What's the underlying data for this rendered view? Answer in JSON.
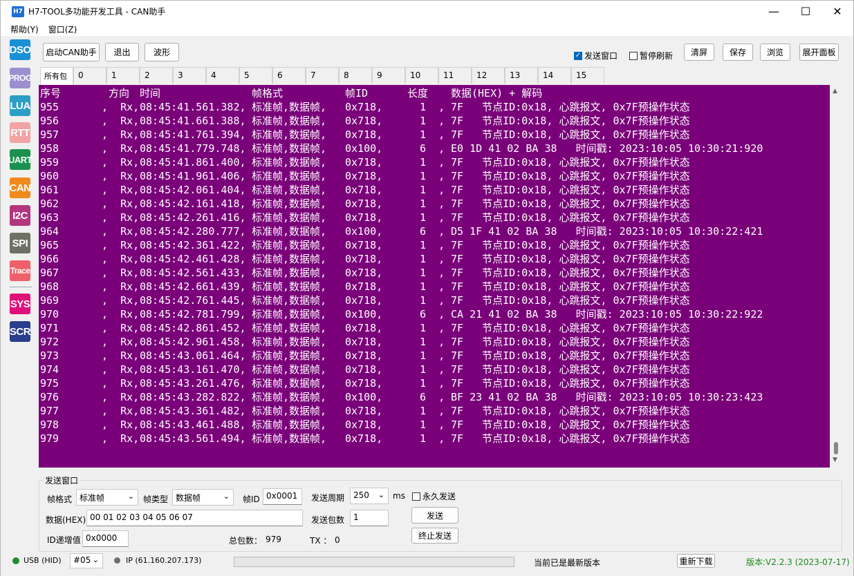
{
  "window": {
    "icon": "H7",
    "title": "H7-TOOL多功能开发工具 - CAN助手",
    "min": "—",
    "max": "☐",
    "close": "✕"
  },
  "menu": [
    "帮助(Y)",
    "窗口(Z)"
  ],
  "sidebar": [
    {
      "label": "DSO",
      "color": "#1a8fd6"
    },
    {
      "label": "PROG",
      "color": "#9c8fd0"
    },
    {
      "label": "LUA",
      "color": "#2a9ec7"
    },
    {
      "label": "RTT",
      "color": "#f2a3a3"
    },
    {
      "label": "UART",
      "color": "#1b9150"
    },
    {
      "label": "CAN",
      "color": "#f08a1c"
    },
    {
      "label": "I2C",
      "color": "#b3357f"
    },
    {
      "label": "SPI",
      "color": "#6f6f63"
    },
    {
      "label": "Trace",
      "color": "#f0606a"
    },
    {
      "label": "SYS",
      "color": "#e0107a"
    },
    {
      "label": "SCR",
      "color": "#2a3e8e"
    }
  ],
  "toolbar": {
    "start_can": "启动CAN助手",
    "exit": "退出",
    "wave": "波形",
    "send_window": "发送窗口",
    "send_window_checked": true,
    "pause_refresh": "暂停刷新",
    "pause_refresh_checked": false,
    "clear": "清屏",
    "save": "保存",
    "browse": "浏览",
    "expand": "展开面板"
  },
  "tabs": [
    "所有包",
    "0",
    "1",
    "2",
    "3",
    "4",
    "5",
    "6",
    "7",
    "8",
    "9",
    "10",
    "11",
    "12",
    "13",
    "14",
    "15"
  ],
  "log": {
    "header": {
      "seq": "序号",
      "dir": "方向",
      "time": "时间",
      "fmt": "帧格式",
      "id": "帧ID",
      "len": "长度",
      "data": "数据(HEX) + 解码"
    },
    "rows": [
      {
        "seq": "955",
        "dir": ",  Rx,",
        "time": "08:45:41.561.382,",
        "fmt": "标准帧,数据帧,",
        "id": "0x718,",
        "len": "1  ,",
        "data": "7F   节点ID:0x18, 心跳报文, 0x7F预操作状态"
      },
      {
        "seq": "956",
        "dir": ",  Rx,",
        "time": "08:45:41.661.388,",
        "fmt": "标准帧,数据帧,",
        "id": "0x718,",
        "len": "1  ,",
        "data": "7F   节点ID:0x18, 心跳报文, 0x7F预操作状态"
      },
      {
        "seq": "957",
        "dir": ",  Rx,",
        "time": "08:45:41.761.394,",
        "fmt": "标准帧,数据帧,",
        "id": "0x718,",
        "len": "1  ,",
        "data": "7F   节点ID:0x18, 心跳报文, 0x7F预操作状态"
      },
      {
        "seq": "958",
        "dir": ",  Rx,",
        "time": "08:45:41.779.748,",
        "fmt": "标准帧,数据帧,",
        "id": "0x100,",
        "len": "6  ,",
        "data": "E0 1D 41 02 BA 38   时间戳: 2023:10:05 10:30:21:920"
      },
      {
        "seq": "959",
        "dir": ",  Rx,",
        "time": "08:45:41.861.400,",
        "fmt": "标准帧,数据帧,",
        "id": "0x718,",
        "len": "1  ,",
        "data": "7F   节点ID:0x18, 心跳报文, 0x7F预操作状态"
      },
      {
        "seq": "960",
        "dir": ",  Rx,",
        "time": "08:45:41.961.406,",
        "fmt": "标准帧,数据帧,",
        "id": "0x718,",
        "len": "1  ,",
        "data": "7F   节点ID:0x18, 心跳报文, 0x7F预操作状态"
      },
      {
        "seq": "961",
        "dir": ",  Rx,",
        "time": "08:45:42.061.404,",
        "fmt": "标准帧,数据帧,",
        "id": "0x718,",
        "len": "1  ,",
        "data": "7F   节点ID:0x18, 心跳报文, 0x7F预操作状态"
      },
      {
        "seq": "962",
        "dir": ",  Rx,",
        "time": "08:45:42.161.418,",
        "fmt": "标准帧,数据帧,",
        "id": "0x718,",
        "len": "1  ,",
        "data": "7F   节点ID:0x18, 心跳报文, 0x7F预操作状态"
      },
      {
        "seq": "963",
        "dir": ",  Rx,",
        "time": "08:45:42.261.416,",
        "fmt": "标准帧,数据帧,",
        "id": "0x718,",
        "len": "1  ,",
        "data": "7F   节点ID:0x18, 心跳报文, 0x7F预操作状态"
      },
      {
        "seq": "964",
        "dir": ",  Rx,",
        "time": "08:45:42.280.777,",
        "fmt": "标准帧,数据帧,",
        "id": "0x100,",
        "len": "6  ,",
        "data": "D5 1F 41 02 BA 38   时间戳: 2023:10:05 10:30:22:421"
      },
      {
        "seq": "965",
        "dir": ",  Rx,",
        "time": "08:45:42.361.422,",
        "fmt": "标准帧,数据帧,",
        "id": "0x718,",
        "len": "1  ,",
        "data": "7F   节点ID:0x18, 心跳报文, 0x7F预操作状态"
      },
      {
        "seq": "966",
        "dir": ",  Rx,",
        "time": "08:45:42.461.428,",
        "fmt": "标准帧,数据帧,",
        "id": "0x718,",
        "len": "1  ,",
        "data": "7F   节点ID:0x18, 心跳报文, 0x7F预操作状态"
      },
      {
        "seq": "967",
        "dir": ",  Rx,",
        "time": "08:45:42.561.433,",
        "fmt": "标准帧,数据帧,",
        "id": "0x718,",
        "len": "1  ,",
        "data": "7F   节点ID:0x18, 心跳报文, 0x7F预操作状态"
      },
      {
        "seq": "968",
        "dir": ",  Rx,",
        "time": "08:45:42.661.439,",
        "fmt": "标准帧,数据帧,",
        "id": "0x718,",
        "len": "1  ,",
        "data": "7F   节点ID:0x18, 心跳报文, 0x7F预操作状态"
      },
      {
        "seq": "969",
        "dir": ",  Rx,",
        "time": "08:45:42.761.445,",
        "fmt": "标准帧,数据帧,",
        "id": "0x718,",
        "len": "1  ,",
        "data": "7F   节点ID:0x18, 心跳报文, 0x7F预操作状态"
      },
      {
        "seq": "970",
        "dir": ",  Rx,",
        "time": "08:45:42.781.799,",
        "fmt": "标准帧,数据帧,",
        "id": "0x100,",
        "len": "6  ,",
        "data": "CA 21 41 02 BA 38   时间戳: 2023:10:05 10:30:22:922"
      },
      {
        "seq": "971",
        "dir": ",  Rx,",
        "time": "08:45:42.861.452,",
        "fmt": "标准帧,数据帧,",
        "id": "0x718,",
        "len": "1  ,",
        "data": "7F   节点ID:0x18, 心跳报文, 0x7F预操作状态"
      },
      {
        "seq": "972",
        "dir": ",  Rx,",
        "time": "08:45:42.961.458,",
        "fmt": "标准帧,数据帧,",
        "id": "0x718,",
        "len": "1  ,",
        "data": "7F   节点ID:0x18, 心跳报文, 0x7F预操作状态"
      },
      {
        "seq": "973",
        "dir": ",  Rx,",
        "time": "08:45:43.061.464,",
        "fmt": "标准帧,数据帧,",
        "id": "0x718,",
        "len": "1  ,",
        "data": "7F   节点ID:0x18, 心跳报文, 0x7F预操作状态"
      },
      {
        "seq": "974",
        "dir": ",  Rx,",
        "time": "08:45:43.161.470,",
        "fmt": "标准帧,数据帧,",
        "id": "0x718,",
        "len": "1  ,",
        "data": "7F   节点ID:0x18, 心跳报文, 0x7F预操作状态"
      },
      {
        "seq": "975",
        "dir": ",  Rx,",
        "time": "08:45:43.261.476,",
        "fmt": "标准帧,数据帧,",
        "id": "0x718,",
        "len": "1  ,",
        "data": "7F   节点ID:0x18, 心跳报文, 0x7F预操作状态"
      },
      {
        "seq": "976",
        "dir": ",  Rx,",
        "time": "08:45:43.282.822,",
        "fmt": "标准帧,数据帧,",
        "id": "0x100,",
        "len": "6  ,",
        "data": "BF 23 41 02 BA 38   时间戳: 2023:10:05 10:30:23:423"
      },
      {
        "seq": "977",
        "dir": ",  Rx,",
        "time": "08:45:43.361.482,",
        "fmt": "标准帧,数据帧,",
        "id": "0x718,",
        "len": "1  ,",
        "data": "7F   节点ID:0x18, 心跳报文, 0x7F预操作状态"
      },
      {
        "seq": "978",
        "dir": ",  Rx,",
        "time": "08:45:43.461.488,",
        "fmt": "标准帧,数据帧,",
        "id": "0x718,",
        "len": "1  ,",
        "data": "7F   节点ID:0x18, 心跳报文, 0x7F预操作状态"
      },
      {
        "seq": "979",
        "dir": ",  Rx,",
        "time": "08:45:43.561.494,",
        "fmt": "标准帧,数据帧,",
        "id": "0x718,",
        "len": "1  ,",
        "data": "7F   节点ID:0x18, 心跳报文, 0x7F预操作状态"
      }
    ]
  },
  "send": {
    "group_title": "发送窗口",
    "frame_format_label": "帧格式",
    "frame_format_value": "标准帧",
    "frame_type_label": "帧类型",
    "frame_type_value": "数据帧",
    "frame_id_label": "帧ID",
    "frame_id_value": "0x0001",
    "period_label": "发送周期",
    "period_value": "250",
    "period_unit": "ms",
    "forever_label": "永久发送",
    "data_label": "数据(HEX)",
    "data_value": "00 01 02 03 04 05 06 07",
    "count_label": "发送包数",
    "count_value": "1",
    "send_button": "发送",
    "stop_button": "终止发送",
    "id_inc_label": "ID递增值",
    "id_inc_value": "0x0000",
    "total_label": "总包数：",
    "total_value": "979",
    "tx_label": "TX ：",
    "tx_value": "0"
  },
  "status": {
    "usb": "USB (HID)",
    "device": "#05",
    "ip": "IP (61.160.207.173)",
    "update_text": "当前已是最新版本",
    "redownload": "重新下载",
    "version": "版本:V2.2.3 (2023-07-17)",
    "usb_color": "#1e8c2e",
    "ip_color": "#6e6e6e",
    "version_color": "#1a8a1a"
  }
}
